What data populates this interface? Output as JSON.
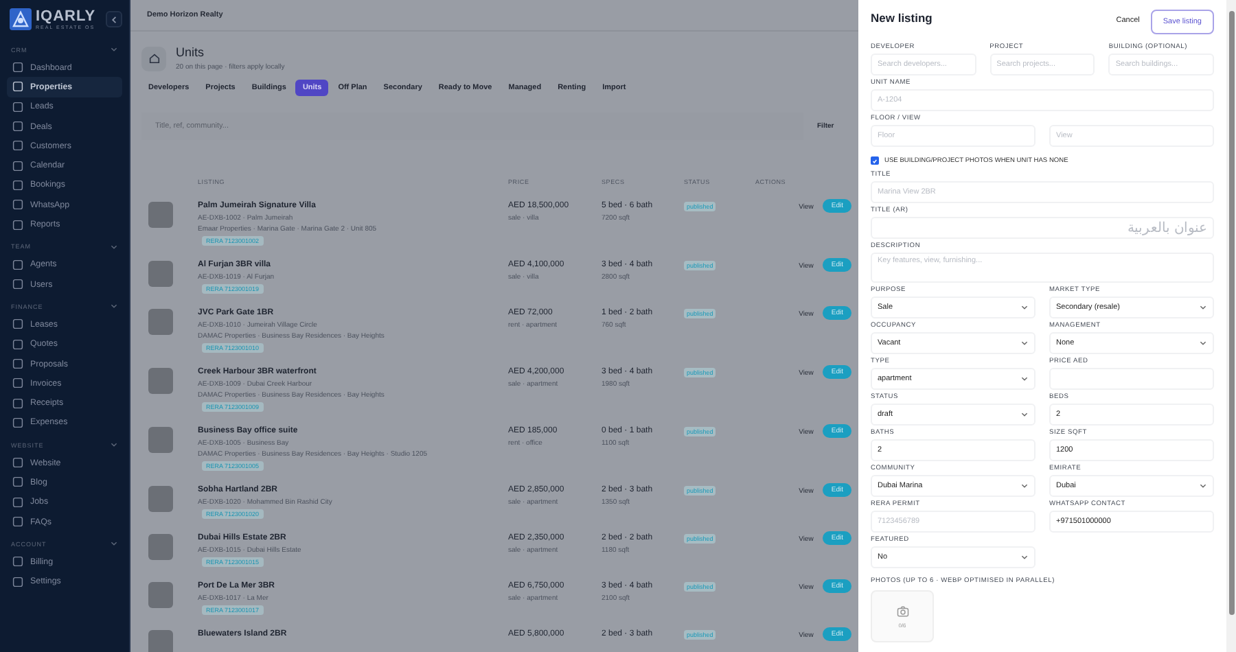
{
  "sidebar": {
    "brand": "IQARLY",
    "tagline": "REAL ESTATE OS",
    "sections": [
      {
        "title": "CRM",
        "items": [
          {
            "label": "Dashboard",
            "selected": false
          },
          {
            "label": "Properties",
            "selected": true
          },
          {
            "label": "Leads",
            "selected": false
          },
          {
            "label": "Deals",
            "selected": false
          },
          {
            "label": "Customers",
            "selected": false
          },
          {
            "label": "Calendar",
            "selected": false
          },
          {
            "label": "Bookings",
            "selected": false
          },
          {
            "label": "WhatsApp",
            "selected": false
          },
          {
            "label": "Reports",
            "selected": false
          }
        ]
      },
      {
        "title": "TEAM",
        "items": [
          {
            "label": "Agents",
            "selected": false
          },
          {
            "label": "Users",
            "selected": false
          }
        ]
      },
      {
        "title": "FINANCE",
        "items": [
          {
            "label": "Leases",
            "selected": false
          },
          {
            "label": "Quotes",
            "selected": false
          },
          {
            "label": "Proposals",
            "selected": false
          },
          {
            "label": "Invoices",
            "selected": false
          },
          {
            "label": "Receipts",
            "selected": false
          },
          {
            "label": "Expenses",
            "selected": false
          }
        ]
      },
      {
        "title": "WEBSITE",
        "items": [
          {
            "label": "Website",
            "selected": false
          },
          {
            "label": "Blog",
            "selected": false
          },
          {
            "label": "Jobs",
            "selected": false
          },
          {
            "label": "FAQs",
            "selected": false
          }
        ]
      },
      {
        "title": "ACCOUNT",
        "items": [
          {
            "label": "Billing",
            "selected": false
          },
          {
            "label": "Settings",
            "selected": false
          }
        ]
      }
    ]
  },
  "topbar": {
    "org": "Demo Horizon Realty"
  },
  "header": {
    "title": "Units",
    "subtitle": "20 on this page · filters apply locally"
  },
  "tabs": [
    {
      "label": "Developers",
      "selected": false
    },
    {
      "label": "Projects",
      "selected": false
    },
    {
      "label": "Buildings",
      "selected": false
    },
    {
      "label": "Units",
      "selected": true
    },
    {
      "label": "Off Plan",
      "selected": false
    },
    {
      "label": "Secondary",
      "selected": false
    },
    {
      "label": "Ready to Move",
      "selected": false
    },
    {
      "label": "Managed",
      "selected": false
    },
    {
      "label": "Renting",
      "selected": false
    },
    {
      "label": "Import",
      "selected": false
    }
  ],
  "search": {
    "placeholder": "Title, ref, community...",
    "filter_label": "Filter"
  },
  "table": {
    "columns": [
      "LISTING",
      "PRICE",
      "SPECS",
      "STATUS",
      "ACTIONS"
    ],
    "rows": [
      {
        "title": "Palm Jumeirah Signature Villa",
        "ref": "AE-DXB-1002 · Palm Jumeirah",
        "details": "Emaar Properties · Marina Gate · Marina Gate 2 · Unit 805",
        "permit": "RERA 7123001002",
        "price": "AED 18,500,000",
        "deal": "sale · villa",
        "specs": "5 bed · 6 bath",
        "area": "7200 sqft",
        "status": "published",
        "actions": [
          "View",
          "Edit"
        ]
      },
      {
        "title": "Al Furjan 3BR villa",
        "ref": "AE-DXB-1019 · Al Furjan",
        "permit": "RERA 7123001019",
        "price": "AED 4,100,000",
        "deal": "sale · villa",
        "specs": "3 bed · 4 bath",
        "area": "2800 sqft",
        "status": "published",
        "actions": [
          "View",
          "Edit"
        ]
      },
      {
        "title": "JVC Park Gate 1BR",
        "ref": "AE-DXB-1010 · Jumeirah Village Circle",
        "details": "DAMAC Properties · Business Bay Residences · Bay Heights",
        "permit": "RERA 7123001010",
        "price": "AED 72,000",
        "deal": "rent · apartment",
        "specs": "1 bed · 2 bath",
        "area": "760 sqft",
        "status": "published",
        "actions": [
          "View",
          "Edit"
        ]
      },
      {
        "title": "Creek Harbour 3BR waterfront",
        "ref": "AE-DXB-1009 · Dubai Creek Harbour",
        "details": "DAMAC Properties · Business Bay Residences · Bay Heights",
        "permit": "RERA 7123001009",
        "price": "AED 4,200,000",
        "deal": "sale · apartment",
        "specs": "3 bed · 4 bath",
        "area": "1980 sqft",
        "status": "published",
        "actions": [
          "View",
          "Edit"
        ]
      },
      {
        "title": "Business Bay office suite",
        "ref": "AE-DXB-1005 · Business Bay",
        "details": "DAMAC Properties · Business Bay Residences · Bay Heights · Studio 1205",
        "permit": "RERA 7123001005",
        "price": "AED 185,000",
        "deal": "rent · office",
        "specs": "0 bed · 1 bath",
        "area": "1100 sqft",
        "status": "published",
        "actions": [
          "View",
          "Edit"
        ]
      },
      {
        "title": "Sobha Hartland 2BR",
        "ref": "AE-DXB-1020 · Mohammed Bin Rashid City",
        "permit": "RERA 7123001020",
        "price": "AED 2,850,000",
        "deal": "sale · apartment",
        "specs": "2 bed · 3 bath",
        "area": "1350 sqft",
        "status": "published",
        "actions": [
          "View",
          "Edit"
        ]
      },
      {
        "title": "Dubai Hills Estate 2BR",
        "ref": "AE-DXB-1015 · Dubai Hills Estate",
        "permit": "RERA 7123001015",
        "price": "AED 2,350,000",
        "deal": "sale · apartment",
        "specs": "2 bed · 2 bath",
        "area": "1180 sqft",
        "status": "published",
        "actions": [
          "View",
          "Edit"
        ]
      },
      {
        "title": "Port De La Mer 3BR",
        "ref": "AE-DXB-1017 · La Mer",
        "permit": "RERA 7123001017",
        "price": "AED 6,750,000",
        "deal": "sale · apartment",
        "specs": "3 bed · 4 bath",
        "area": "2100 sqft",
        "status": "published",
        "actions": [
          "View",
          "Edit"
        ]
      },
      {
        "title": "Bluewaters Island 2BR",
        "price": "AED 5,800,000",
        "specs": "2 bed · 3 bath",
        "status": "published",
        "actions": [
          "View",
          "Edit"
        ]
      }
    ]
  },
  "panel": {
    "title": "New listing",
    "cancel": "Cancel",
    "save": "Save listing",
    "rows": [
      {
        "kind": "fields",
        "fields": [
          {
            "label": "DEVELOPER",
            "kind": "input",
            "placeholder": "Search developers..."
          },
          {
            "label": "PROJECT",
            "kind": "input",
            "placeholder": "Search projects..."
          },
          {
            "label": "BUILDING (OPTIONAL)",
            "kind": "input",
            "placeholder": "Search buildings..."
          }
        ]
      },
      {
        "kind": "fields",
        "fields": [
          {
            "label": "UNIT NAME",
            "kind": "input",
            "placeholder": "A-1204"
          }
        ]
      },
      {
        "kind": "pair",
        "label": "FLOOR / VIEW",
        "inputs": [
          {
            "placeholder": "Floor"
          },
          {
            "placeholder": "View"
          }
        ]
      },
      {
        "kind": "checkbox",
        "label": "USE BUILDING/PROJECT PHOTOS WHEN UNIT HAS NONE",
        "checked": true
      },
      {
        "kind": "fields",
        "fields": [
          {
            "label": "TITLE",
            "kind": "input",
            "placeholder": "Marina View 2BR"
          }
        ]
      },
      {
        "kind": "fields",
        "fields": [
          {
            "label": "TITLE (AR)",
            "kind": "rtl_input",
            "placeholder": "عنوان بالعربية"
          }
        ]
      },
      {
        "kind": "fields",
        "fields": [
          {
            "label": "DESCRIPTION",
            "kind": "textarea",
            "placeholder": "Key features, view, furnishing..."
          }
        ]
      },
      {
        "kind": "fields",
        "fields": [
          {
            "label": "PURPOSE",
            "kind": "select",
            "value": "Sale"
          },
          {
            "label": "MARKET TYPE",
            "kind": "select",
            "value": "Secondary (resale)"
          }
        ]
      },
      {
        "kind": "fields",
        "fields": [
          {
            "label": "OCCUPANCY",
            "kind": "select",
            "value": "Vacant"
          },
          {
            "label": "MANAGEMENT",
            "kind": "select",
            "value": "None"
          }
        ]
      },
      {
        "kind": "fields",
        "fields": [
          {
            "label": "TYPE",
            "kind": "select",
            "value": "apartment"
          },
          {
            "label": "PRICE AED",
            "kind": "input"
          }
        ]
      },
      {
        "kind": "fields",
        "fields": [
          {
            "label": "STATUS",
            "kind": "select",
            "value": "draft"
          },
          {
            "label": "BEDS",
            "kind": "input",
            "value": "2"
          }
        ]
      },
      {
        "kind": "fields",
        "fields": [
          {
            "label": "BATHS",
            "kind": "input",
            "value": "2"
          },
          {
            "label": "SIZE SQFT",
            "kind": "input",
            "value": "1200"
          }
        ]
      },
      {
        "kind": "fields",
        "fields": [
          {
            "label": "COMMUNITY",
            "kind": "select",
            "value": "Dubai Marina"
          },
          {
            "label": "EMIRATE",
            "kind": "select",
            "value": "Dubai"
          }
        ]
      },
      {
        "kind": "fields",
        "fields": [
          {
            "label": "RERA PERMIT",
            "kind": "input",
            "placeholder": "7123456789"
          },
          {
            "label": "WHATSAPP CONTACT",
            "kind": "input",
            "value": "+971501000000"
          }
        ]
      },
      {
        "kind": "fields",
        "fields": [
          {
            "label": "FEATURED",
            "kind": "select",
            "value": "No"
          },
          {
            "kind": "blank"
          }
        ]
      },
      {
        "kind": "photos",
        "label": "PHOTOS (UP TO 6 · WEBP OPTIMISED IN PARALLEL)",
        "count": "0/6"
      }
    ]
  }
}
